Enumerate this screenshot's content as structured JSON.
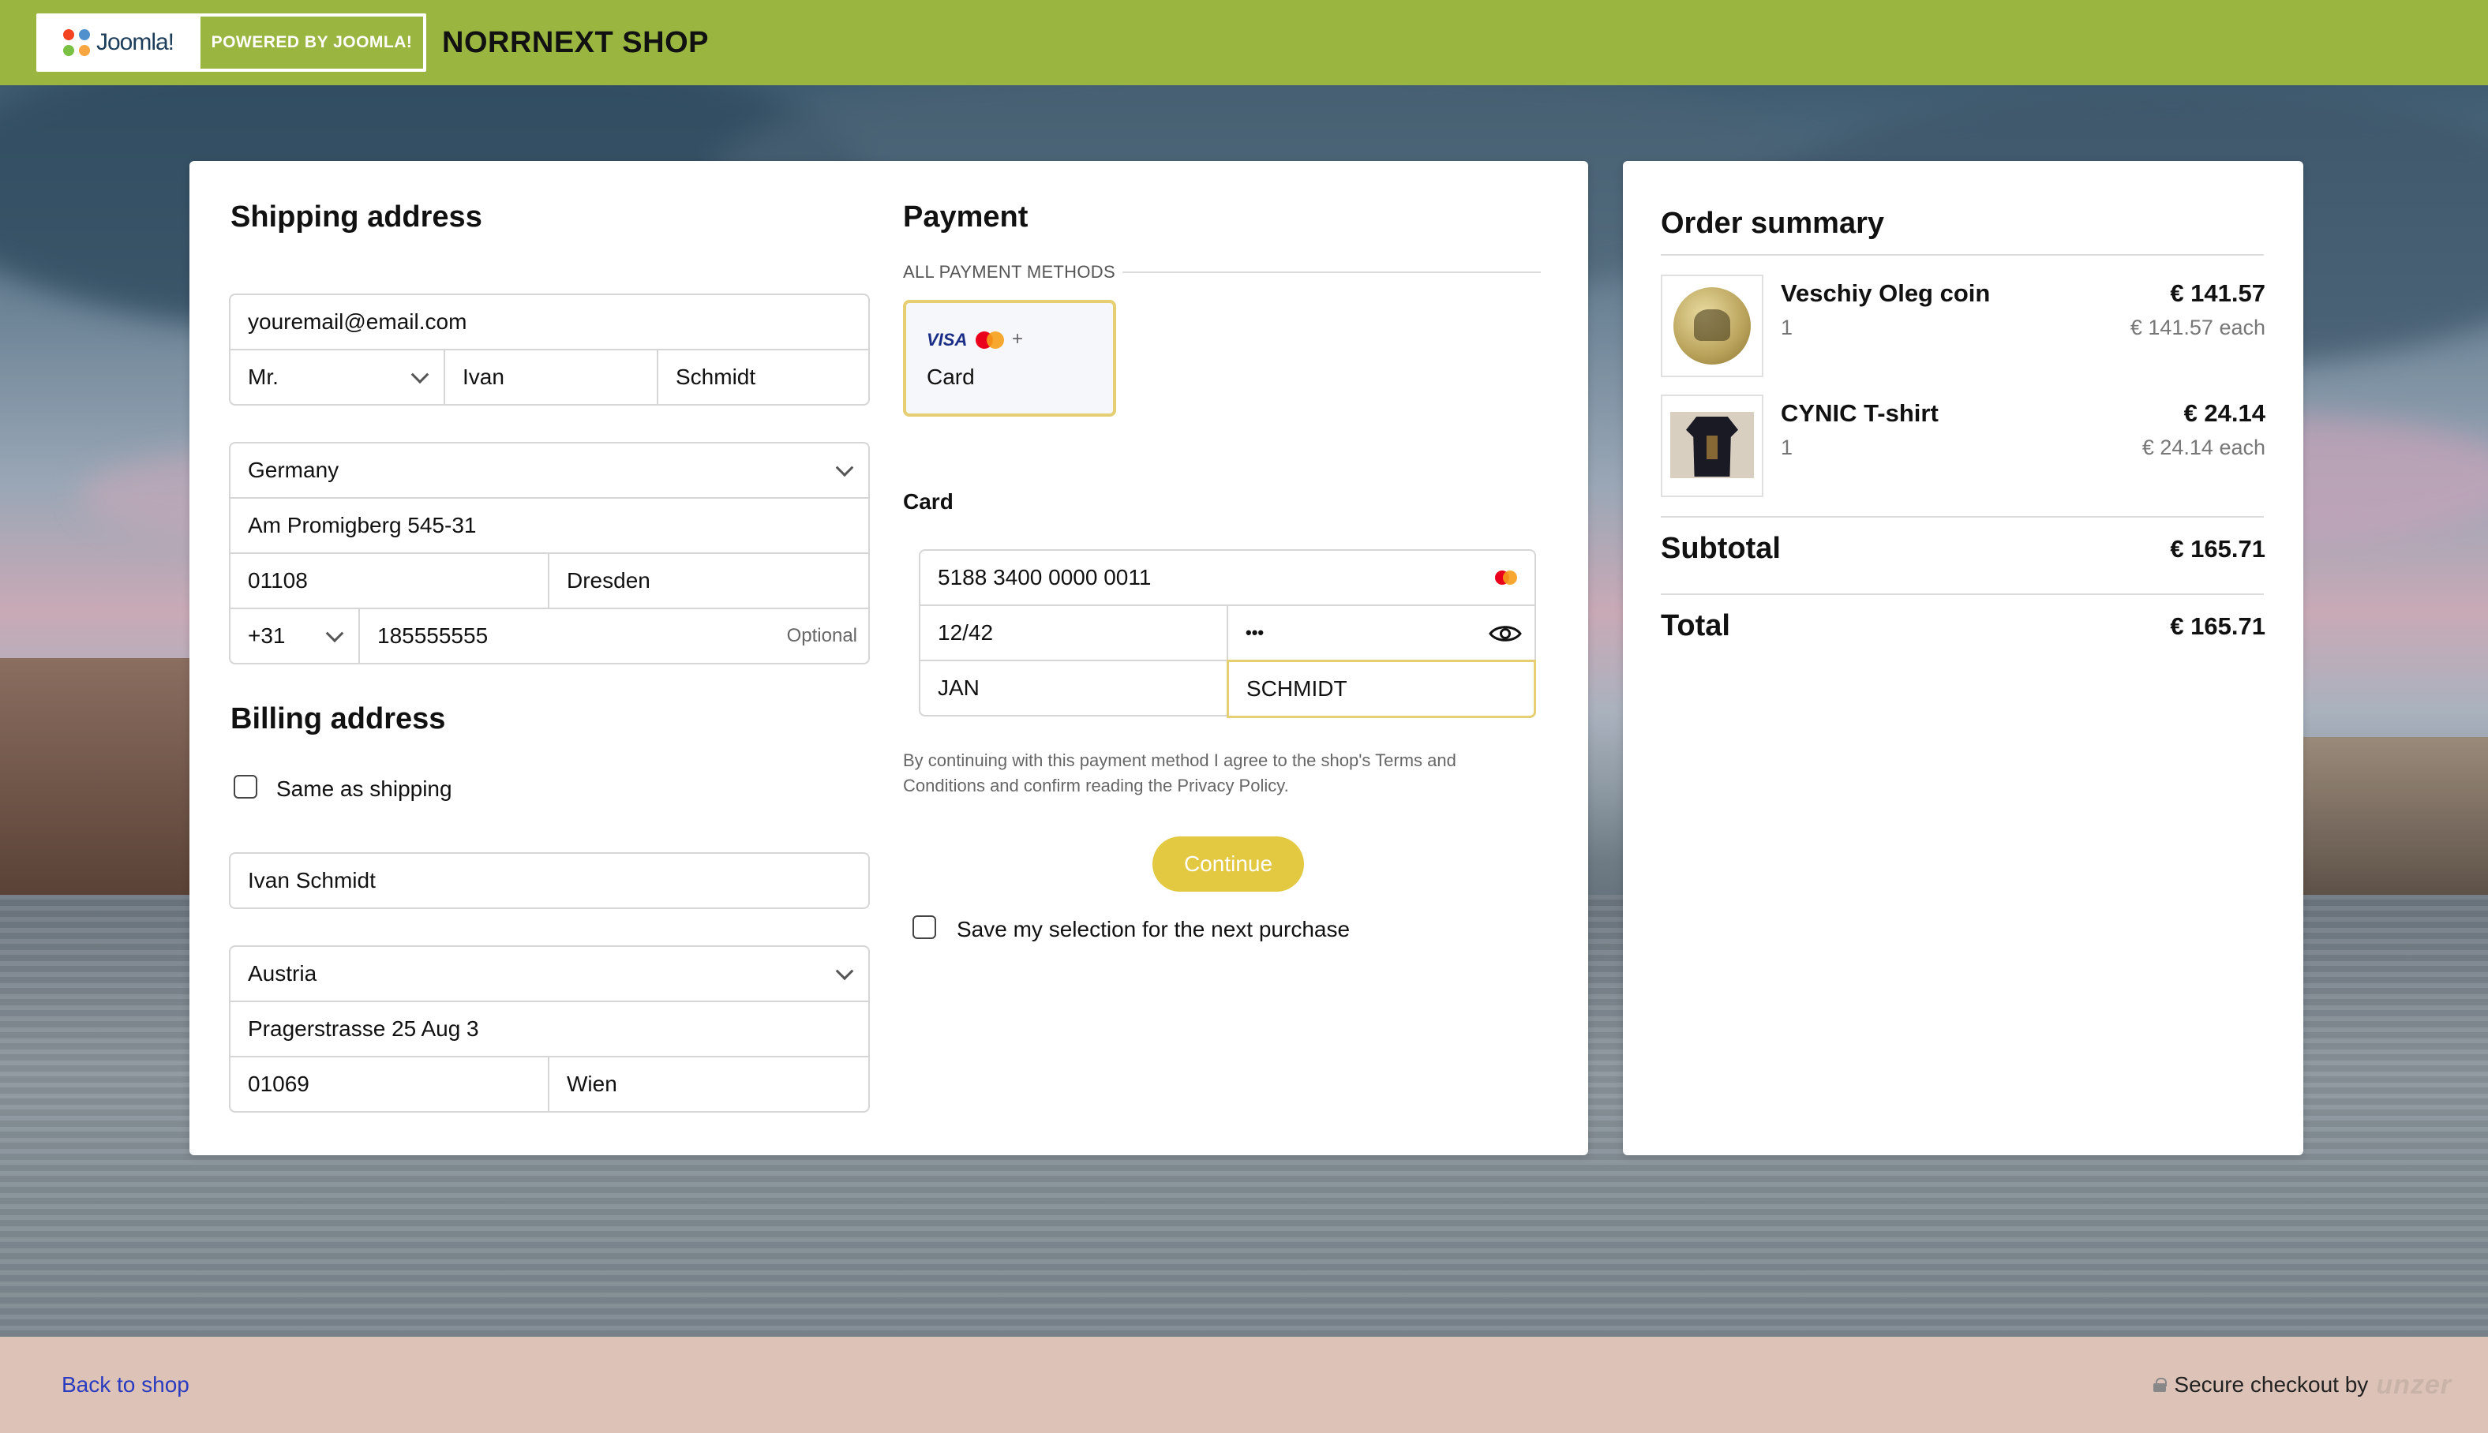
{
  "header": {
    "joomla_logo_text": "Joomla!",
    "powered_label": "POWERED BY JOOMLA!",
    "shop_title": "NORRNEXT SHOP"
  },
  "shipping": {
    "heading": "Shipping address",
    "email": "youremail@email.com",
    "salutation": "Mr.",
    "first_name": "Ivan",
    "last_name": "Schmidt",
    "country": "Germany",
    "street": "Am Promigberg 545-31",
    "zip": "01108",
    "city": "Dresden",
    "phone_code": "+31",
    "phone": "185555555",
    "phone_optional": "Optional"
  },
  "billing": {
    "heading": "Billing address",
    "same_as_shipping_label": "Same as shipping",
    "same_as_shipping_checked": false,
    "name": "Ivan Schmidt",
    "country": "Austria",
    "street": "Pragerstrasse 25 Aug 3",
    "zip": "01069",
    "city": "Wien"
  },
  "payment": {
    "heading": "Payment",
    "methods_label": "ALL PAYMENT METHODS",
    "method_card": {
      "brand_text": "VISA",
      "plus": "+",
      "label": "Card",
      "selected": true
    },
    "card_section_label": "Card",
    "card_number": "5188 3400 0000 0011",
    "expiry": "12/42",
    "cvc": "•••",
    "holder_first": "JAN",
    "holder_last": "SCHMIDT",
    "terms_text_line1": "By continuing with this payment method I agree to the shop's Terms and",
    "terms_text_line2": "Conditions and confirm reading the Privacy Policy.",
    "continue_label": "Continue",
    "save_selection_label": "Save my selection for the next purchase",
    "save_selection_checked": false
  },
  "summary": {
    "heading": "Order summary",
    "items": [
      {
        "name": "Veschiy Oleg coin",
        "qty": "1",
        "price": "€ 141.57",
        "each": "€ 141.57 each",
        "icon": "coin-image"
      },
      {
        "name": "CYNIC T-shirt",
        "qty": "1",
        "price": "€ 24.14",
        "each": "€ 24.14 each",
        "icon": "tshirt-image"
      }
    ],
    "subtotal_label": "Subtotal",
    "subtotal_value": "€ 165.71",
    "total_label": "Total",
    "total_value": "€ 165.71"
  },
  "footer": {
    "back_link": "Back to shop",
    "secure_text": "Secure checkout by",
    "brand": "unzer"
  },
  "colors": {
    "header_green": "#9ab641",
    "accent_yellow": "#e3c842",
    "footer_bg": "#ddc3b7",
    "link_blue": "#2a3bbf"
  }
}
